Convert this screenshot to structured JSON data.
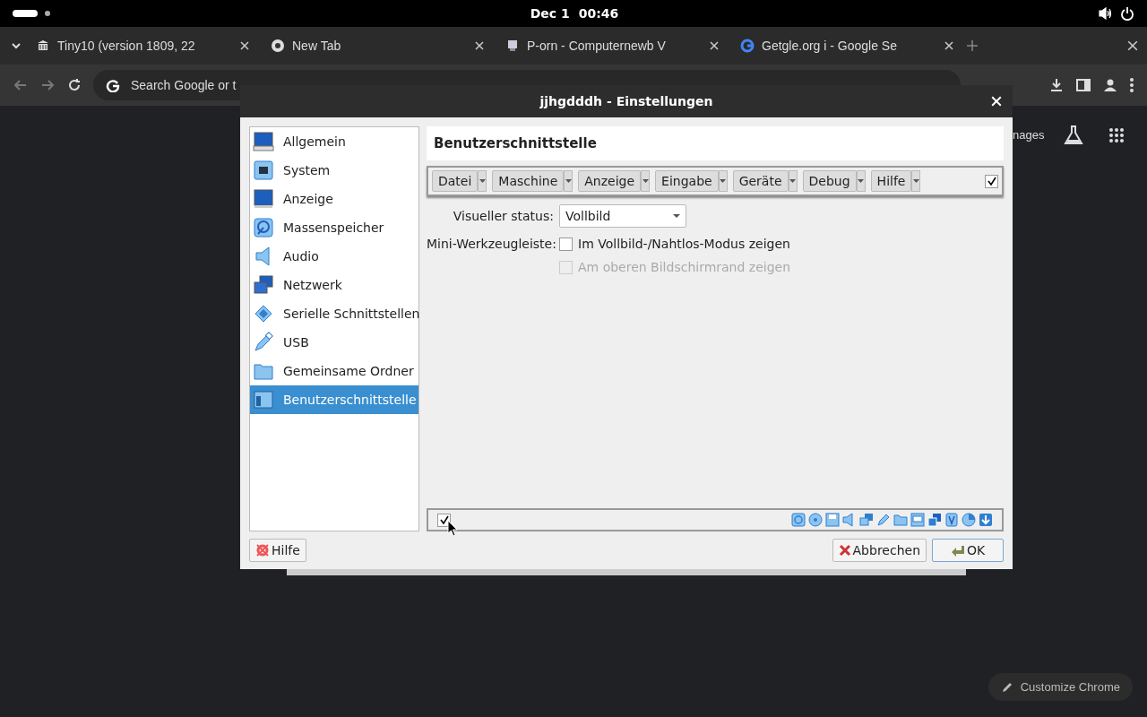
{
  "system_bar": {
    "date": "Dec 1",
    "time": "00:46"
  },
  "browser": {
    "tabs": [
      {
        "title": "Tiny10 (version 1809, 22",
        "kind": "archive"
      },
      {
        "title": "New Tab",
        "kind": "chrome"
      },
      {
        "title": "P-orn - Computernewb V",
        "kind": "site"
      },
      {
        "title": "Getgle.org i - Google Se",
        "kind": "google"
      }
    ],
    "omnibox": {
      "placeholder": "Search Google or t"
    },
    "page_link": "nages",
    "customize_button": "Customize Chrome"
  },
  "dialog": {
    "title": "jjhgdddh - Einstellungen",
    "sidebar": [
      {
        "label": "Allgemein",
        "kind": "general",
        "selected": false
      },
      {
        "label": "System",
        "kind": "system",
        "selected": false
      },
      {
        "label": "Anzeige",
        "kind": "display",
        "selected": false
      },
      {
        "label": "Massenspeicher",
        "kind": "storage",
        "selected": false
      },
      {
        "label": "Audio",
        "kind": "audio",
        "selected": false
      },
      {
        "label": "Netzwerk",
        "kind": "network",
        "selected": false
      },
      {
        "label": "Serielle Schnittstellen",
        "kind": "serial",
        "selected": false
      },
      {
        "label": "USB",
        "kind": "usb",
        "selected": false
      },
      {
        "label": "Gemeinsame Ordner",
        "kind": "folder",
        "selected": false
      },
      {
        "label": "Benutzerschnittstelle",
        "kind": "ui",
        "selected": true
      }
    ],
    "heading": "Benutzerschnittstelle",
    "menus": [
      "Datei",
      "Maschine",
      "Anzeige",
      "Eingabe",
      "Geräte",
      "Debug",
      "Hilfe"
    ],
    "menubar_checked": true,
    "visual_state": {
      "label": "Visueller status:",
      "value": "Vollbild"
    },
    "mini_toolbar": {
      "label": "Mini-Werkzeugleiste:",
      "options": [
        {
          "label": "Im Vollbild-/Nahtlos-Modus zeigen",
          "checked": false,
          "disabled": false
        },
        {
          "label": "Am oberen Bildschirmrand zeigen",
          "checked": false,
          "disabled": true
        }
      ]
    },
    "statusbar_checked": true,
    "buttons": {
      "help": "Hilfe",
      "cancel": "Abbrechen",
      "ok": "OK"
    }
  }
}
